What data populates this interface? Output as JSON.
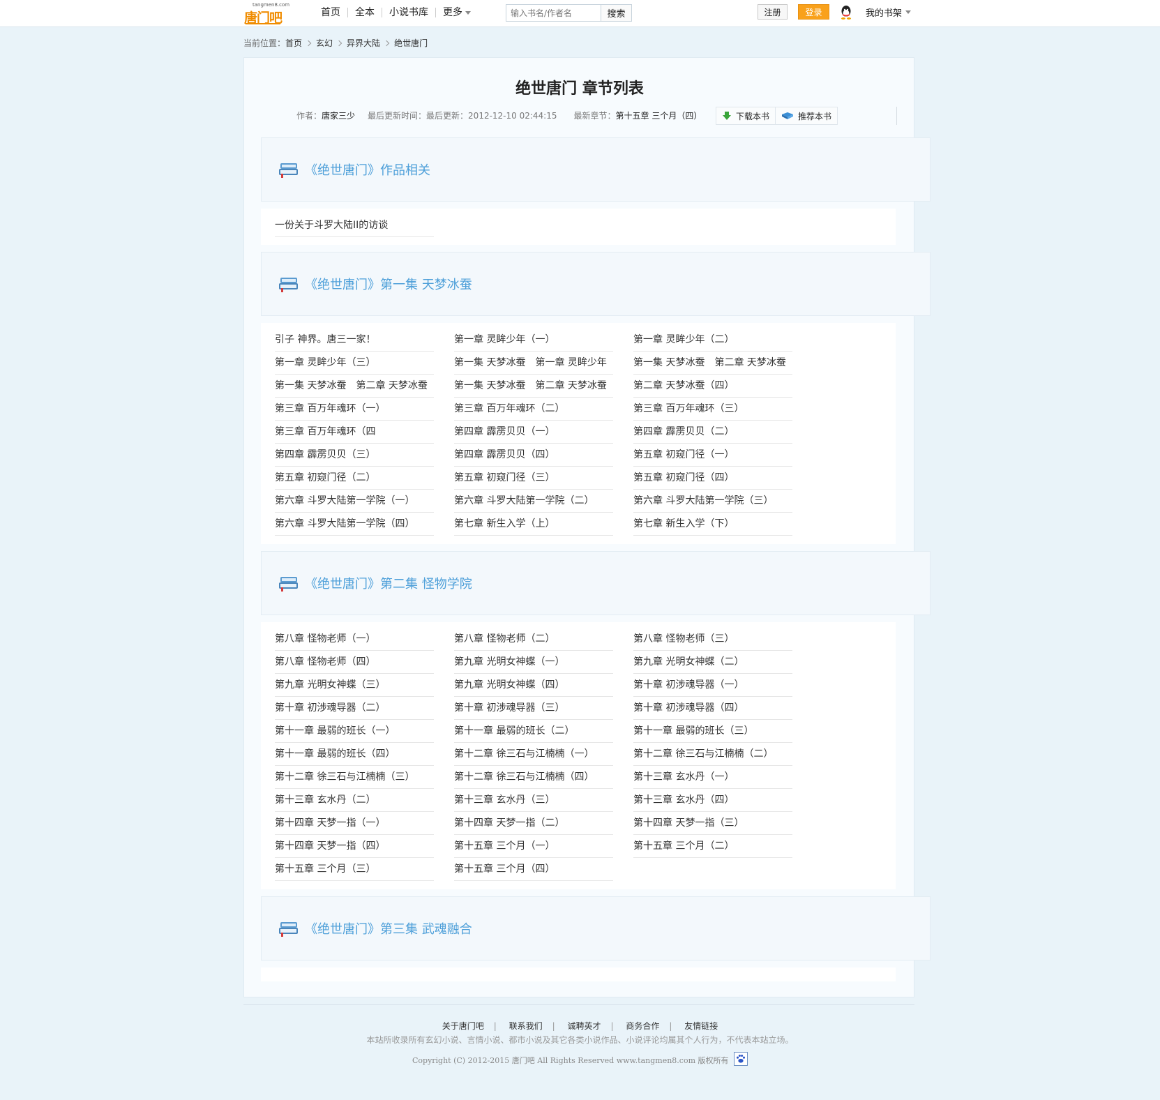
{
  "header": {
    "logo_small": "tangmen8.com",
    "logo_main": "唐门吧",
    "nav": [
      "首页",
      "全本",
      "小说书库",
      "更多"
    ],
    "search_placeholder": "输入书名/作者名",
    "search_button": "搜索",
    "register": "注册",
    "login": "登录",
    "shelf": "我的书架"
  },
  "breadcrumb": {
    "prefix": "当前位置：",
    "items": [
      "首页",
      "玄幻",
      "异界大陆",
      "绝世唐门"
    ]
  },
  "book": {
    "title": "绝世唐门 章节列表",
    "author_label": "作者：",
    "author": "唐家三少",
    "updated_label": "最后更新时间：最后更新：",
    "updated": "2012-12-10 02:44:15",
    "latest_label": "最新章节：",
    "latest": "第十五章 三个月（四）",
    "download": "下载本书",
    "recommend": "推荐本书"
  },
  "volumes": [
    {
      "title": "《绝世唐门》作品相关",
      "chapters": [
        "一份关于斗罗大陆II的访谈"
      ]
    },
    {
      "title": "《绝世唐门》第一集 天梦冰蚕",
      "chapters": [
        "引子 神界。唐三一家！",
        "第一章 灵眸少年（一）",
        "第一章 灵眸少年（二）",
        "第一章 灵眸少年（三）",
        "第一集 天梦冰蚕　第一章 灵眸少年",
        "第一集 天梦冰蚕　第二章 天梦冰蚕",
        "第一集 天梦冰蚕　第二章 天梦冰蚕",
        "第一集 天梦冰蚕　第二章 天梦冰蚕",
        "第二章 天梦冰蚕（四）",
        "第三章 百万年魂环（一）",
        "第三章 百万年魂环（二）",
        "第三章 百万年魂环（三）",
        "第三章 百万年魂环（四",
        "第四章 霹雳贝贝（一）",
        "第四章 霹雳贝贝（二）",
        "第四章 霹雳贝贝（三）",
        "第四章 霹雳贝贝（四）",
        "第五章 初窥门径（一）",
        "第五章 初窥门径（二）",
        "第五章 初窥门径（三）",
        "第五章 初窥门径（四）",
        "第六章 斗罗大陆第一学院（一）",
        "第六章 斗罗大陆第一学院（二）",
        "第六章 斗罗大陆第一学院（三）",
        "第六章 斗罗大陆第一学院（四）",
        "第七章 新生入学（上）",
        "第七章 新生入学（下）"
      ]
    },
    {
      "title": "《绝世唐门》第二集 怪物学院",
      "chapters": [
        "第八章 怪物老师（一）",
        "第八章 怪物老师（二）",
        "第八章 怪物老师（三）",
        "第八章 怪物老师（四）",
        "第九章 光明女神蝶（一）",
        "第九章 光明女神蝶（二）",
        "第九章 光明女神蝶（三）",
        "第九章 光明女神蝶（四）",
        "第十章 初涉魂导器（一）",
        "第十章 初涉魂导器（二）",
        "第十章 初涉魂导器（三）",
        "第十章 初涉魂导器（四）",
        "第十一章 最弱的班长（一）",
        "第十一章 最弱的班长（二）",
        "第十一章 最弱的班长（三）",
        "第十一章 最弱的班长（四）",
        "第十二章 徐三石与江楠楠（一）",
        "第十二章 徐三石与江楠楠（二）",
        "第十二章 徐三石与江楠楠（三）",
        "第十二章 徐三石与江楠楠（四）",
        "第十三章 玄水丹（一）",
        "第十三章 玄水丹（二）",
        "第十三章 玄水丹（三）",
        "第十三章 玄水丹（四）",
        "第十四章 天梦一指（一）",
        "第十四章 天梦一指（二）",
        "第十四章 天梦一指（三）",
        "第十四章 天梦一指（四）",
        "第十五章 三个月（一）",
        "第十五章 三个月（二）",
        "第十五章 三个月（三）",
        "第十五章 三个月（四）"
      ]
    },
    {
      "title": "《绝世唐门》第三集 武魂融合",
      "chapters": []
    }
  ],
  "footer": {
    "links": [
      "关于唐门吧",
      "联系我们",
      "诚聘英才",
      "商务合作",
      "友情链接"
    ],
    "note": "本站所收录所有玄幻小说、言情小说、都市小说及其它各类小说作品、小说评论均属其个人行为，不代表本站立场。",
    "copyright": "Copyright (C) 2012-2015 唐门吧 All Rights Reserved www.tangmen8.com 版权所有"
  },
  "colors": {
    "accent": "#4d9fd9",
    "login": "#f9a11b",
    "background": "#e9f3f9"
  }
}
